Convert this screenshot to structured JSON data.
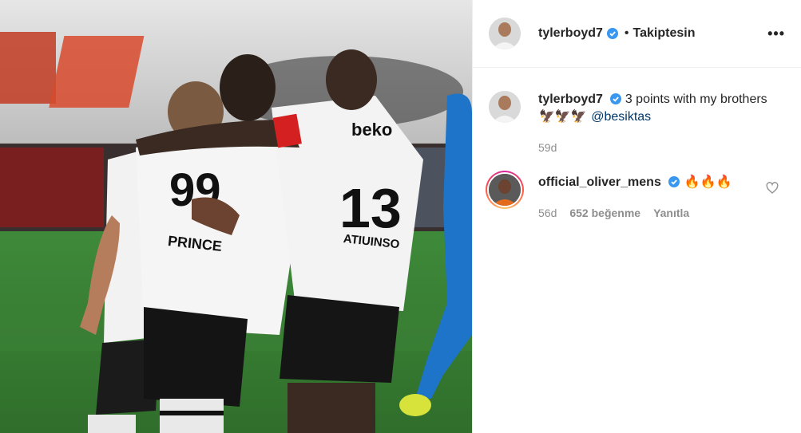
{
  "header": {
    "username": "tylerboyd7",
    "separator": "•",
    "follow_status": "Takiptesin",
    "more_icon": "more-horizontal-icon"
  },
  "photo": {
    "jersey_number_left": "99",
    "jersey_name_left": "PRINCE",
    "jersey_number_right": "13",
    "jersey_name_right": "ATIUINSO",
    "sponsor": "beko"
  },
  "caption": {
    "username": "tylerboyd7",
    "text": "3 points with my brothers",
    "emojis": "🦅🦅🦅",
    "mention": "@besiktas",
    "time": "59d"
  },
  "comment": {
    "username": "official_oliver_mens",
    "text": "🔥🔥🔥",
    "time": "56d",
    "likes": "652 beğenme",
    "reply": "Yanıtla"
  },
  "colors": {
    "verified": "#3897f0",
    "mention": "#00376b",
    "muted": "#8e8e8e"
  }
}
